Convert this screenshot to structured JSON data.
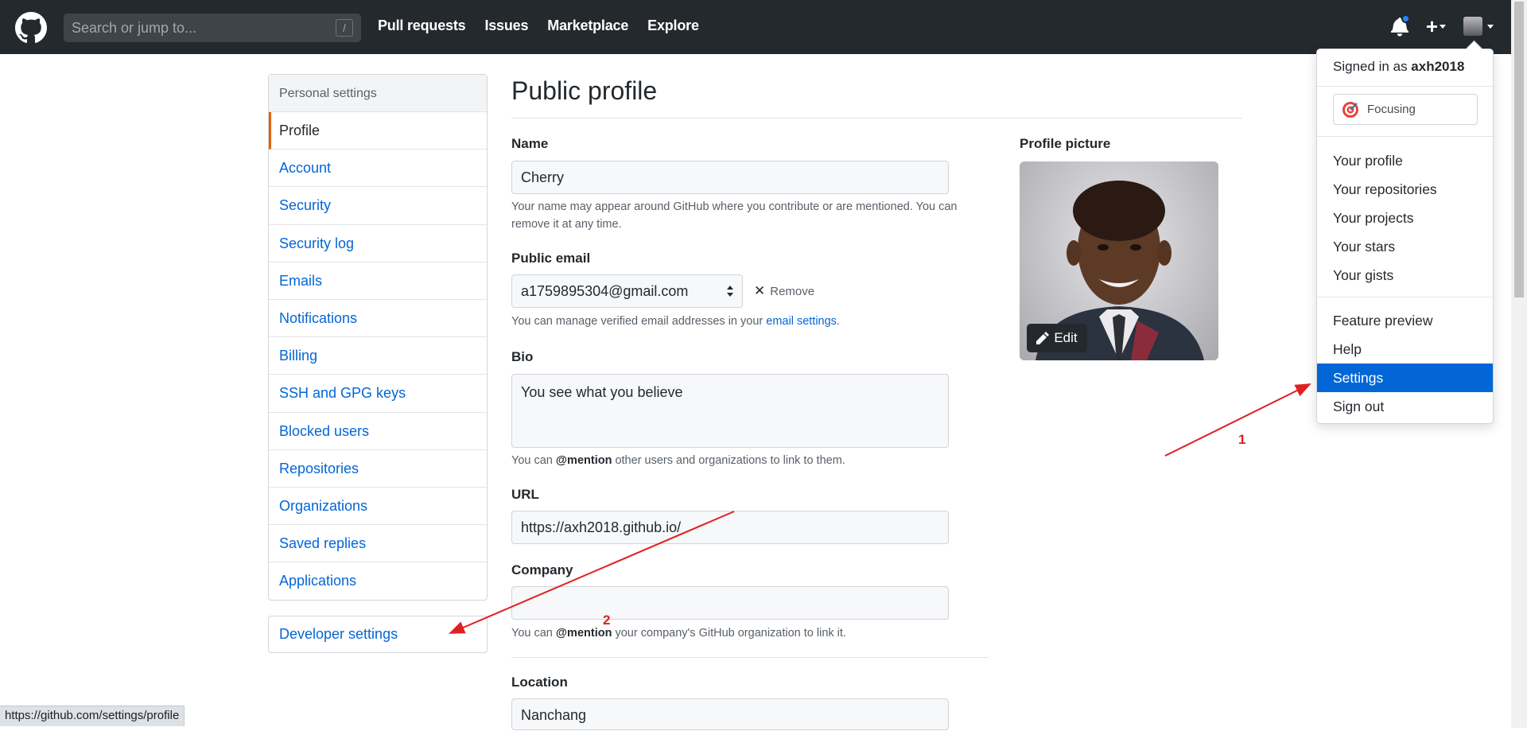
{
  "header": {
    "search_placeholder": "Search or jump to...",
    "search_shortcut": "/",
    "nav": [
      "Pull requests",
      "Issues",
      "Marketplace",
      "Explore"
    ]
  },
  "sidebar": {
    "heading": "Personal settings",
    "items": [
      {
        "label": "Profile",
        "active": true
      },
      {
        "label": "Account"
      },
      {
        "label": "Security"
      },
      {
        "label": "Security log"
      },
      {
        "label": "Emails"
      },
      {
        "label": "Notifications"
      },
      {
        "label": "Billing"
      },
      {
        "label": "SSH and GPG keys"
      },
      {
        "label": "Blocked users"
      },
      {
        "label": "Repositories"
      },
      {
        "label": "Organizations"
      },
      {
        "label": "Saved replies"
      },
      {
        "label": "Applications"
      }
    ],
    "developer": "Developer settings"
  },
  "main": {
    "title": "Public profile",
    "name_label": "Name",
    "name_value": "Cherry",
    "name_note": "Your name may appear around GitHub where you contribute or are mentioned. You can remove it at any time.",
    "email_label": "Public email",
    "email_value": "a1759895304@gmail.com",
    "remove": "Remove",
    "email_note_pre": "You can manage verified email addresses in your ",
    "email_note_link": "email settings",
    "email_note_post": ".",
    "bio_label": "Bio",
    "bio_value": "You see what you believe",
    "bio_note_pre": "You can ",
    "bio_note_mention": "@mention",
    "bio_note_post": " other users and organizations to link to them.",
    "url_label": "URL",
    "url_value": "https://axh2018.github.io/",
    "company_label": "Company",
    "company_value": "",
    "company_note_pre": "You can ",
    "company_note_mention": "@mention",
    "company_note_post": " your company's GitHub organization to link it.",
    "location_label": "Location",
    "location_value": "Nanchang",
    "pp_label": "Profile picture",
    "edit": "Edit"
  },
  "dropdown": {
    "signed_in_as": "Signed in as ",
    "username": "axh2018",
    "status": "Focusing",
    "group1": [
      "Your profile",
      "Your repositories",
      "Your projects",
      "Your stars",
      "Your gists"
    ],
    "group2": [
      "Feature preview",
      "Help",
      "Settings",
      "Sign out"
    ]
  },
  "annotations": {
    "one": "1",
    "two": "2"
  },
  "statusbar": "https://github.com/settings/profile",
  "colors": {
    "header_bg": "#24292e",
    "link": "#0366d6",
    "active_border": "#e36209",
    "annotation": "#e02020"
  }
}
